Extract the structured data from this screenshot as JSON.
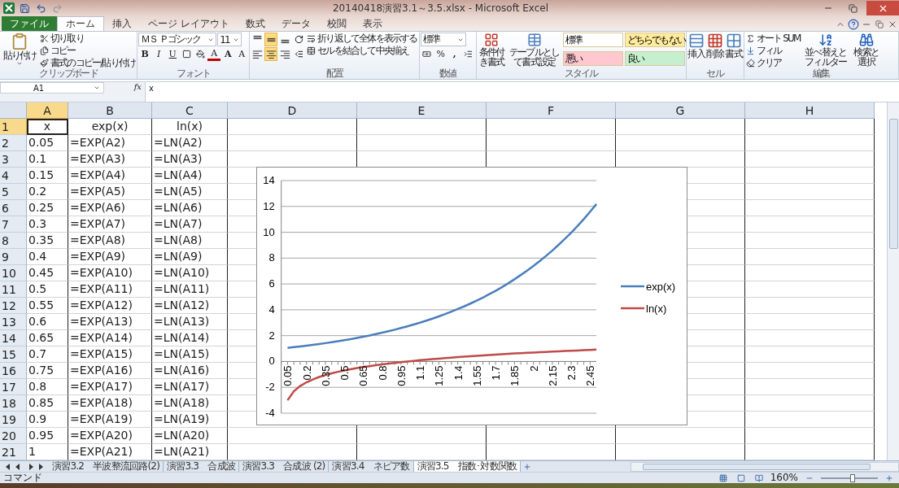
{
  "window": {
    "title": "20140418演習3.1～3.5.xlsx - Microsoft Excel"
  },
  "ribbon_tabs": [
    {
      "label": "ファイル",
      "kind": "file",
      "selected": false
    },
    {
      "label": "ホーム",
      "kind": "tab",
      "selected": true
    },
    {
      "label": "挿入",
      "kind": "tab",
      "selected": false
    },
    {
      "label": "ページ レイアウト",
      "kind": "tab",
      "selected": false
    },
    {
      "label": "数式",
      "kind": "tab",
      "selected": false
    },
    {
      "label": "データ",
      "kind": "tab",
      "selected": false
    },
    {
      "label": "校閲",
      "kind": "tab",
      "selected": false
    },
    {
      "label": "表示",
      "kind": "tab",
      "selected": false
    }
  ],
  "clipboard": {
    "paste": "貼り付け",
    "cut": "切り取り",
    "copy": "コピー",
    "format_painter": "書式のコピー/貼り付け",
    "label": "クリップボード"
  },
  "font": {
    "name": "ＭＳ Ｐゴシック",
    "size": "11",
    "grow": "A",
    "shrink": "A",
    "bold": "B",
    "italic": "I",
    "underline": "U",
    "font_color_letter": "A",
    "label": "フォント"
  },
  "alignment": {
    "vertical": [
      {
        "kind": "top",
        "selected": false
      },
      {
        "kind": "middle",
        "selected": true
      },
      {
        "kind": "bottom",
        "selected": false
      }
    ],
    "horizontal": [
      {
        "kind": "left",
        "selected": false
      },
      {
        "kind": "center",
        "selected": true
      },
      {
        "kind": "right",
        "selected": false
      }
    ],
    "wrap": "折り返して全体を表示する",
    "merge": "セルを結合して中央揃え",
    "label": "配置"
  },
  "number": {
    "format": "標準",
    "percent": "%",
    "comma": ",",
    "label": "数値"
  },
  "styles": {
    "conditional": "条件付き書式",
    "table": "テーブルとして書式設定",
    "cells": [
      {
        "label": "標準",
        "color": "#ffffff"
      },
      {
        "label": "どちらでもない",
        "color": "#ffeb9c"
      },
      {
        "label": "悪い",
        "color": "#ffc7ce"
      },
      {
        "label": "良い",
        "color": "#c6efce"
      }
    ],
    "label": "スタイル"
  },
  "cells": {
    "insert": "挿入",
    "delete": "削除",
    "format": "書式",
    "label": "セル"
  },
  "editing": {
    "autosum": "オート SUM",
    "fill": "フィル",
    "clear": "クリア",
    "sort": "並べ替えとフィルター",
    "find": "検索と選択",
    "label": "編集"
  },
  "formula_bar": {
    "name_box": "A1",
    "fx": "fx",
    "value": "x"
  },
  "columns": [
    {
      "label": "A",
      "selected": true
    },
    {
      "label": "B",
      "selected": false
    },
    {
      "label": "C",
      "selected": false
    },
    {
      "label": "D",
      "selected": false
    },
    {
      "label": "E",
      "selected": false
    },
    {
      "label": "F",
      "selected": false
    },
    {
      "label": "G",
      "selected": false
    },
    {
      "label": "H",
      "selected": false
    }
  ],
  "rows": [
    {
      "header": "1",
      "selected": true,
      "kind": "header",
      "cells": [
        "x",
        "exp(x)",
        "ln(x)"
      ]
    },
    {
      "header": "2",
      "selected": false,
      "kind": "data",
      "cells": [
        "0.05",
        "=EXP(A2)",
        "=LN(A2)"
      ]
    },
    {
      "header": "3",
      "selected": false,
      "kind": "data",
      "cells": [
        "0.1",
        "=EXP(A3)",
        "=LN(A3)"
      ]
    },
    {
      "header": "4",
      "selected": false,
      "kind": "data",
      "cells": [
        "0.15",
        "=EXP(A4)",
        "=LN(A4)"
      ]
    },
    {
      "header": "5",
      "selected": false,
      "kind": "data",
      "cells": [
        "0.2",
        "=EXP(A5)",
        "=LN(A5)"
      ]
    },
    {
      "header": "6",
      "selected": false,
      "kind": "data",
      "cells": [
        "0.25",
        "=EXP(A6)",
        "=LN(A6)"
      ]
    },
    {
      "header": "7",
      "selected": false,
      "kind": "data",
      "cells": [
        "0.3",
        "=EXP(A7)",
        "=LN(A7)"
      ]
    },
    {
      "header": "8",
      "selected": false,
      "kind": "data",
      "cells": [
        "0.35",
        "=EXP(A8)",
        "=LN(A8)"
      ]
    },
    {
      "header": "9",
      "selected": false,
      "kind": "data",
      "cells": [
        "0.4",
        "=EXP(A9)",
        "=LN(A9)"
      ]
    },
    {
      "header": "10",
      "selected": false,
      "kind": "data",
      "cells": [
        "0.45",
        "=EXP(A10)",
        "=LN(A10)"
      ]
    },
    {
      "header": "11",
      "selected": false,
      "kind": "data",
      "cells": [
        "0.5",
        "=EXP(A11)",
        "=LN(A11)"
      ]
    },
    {
      "header": "12",
      "selected": false,
      "kind": "data",
      "cells": [
        "0.55",
        "=EXP(A12)",
        "=LN(A12)"
      ]
    },
    {
      "header": "13",
      "selected": false,
      "kind": "data",
      "cells": [
        "0.6",
        "=EXP(A13)",
        "=LN(A13)"
      ]
    },
    {
      "header": "14",
      "selected": false,
      "kind": "data",
      "cells": [
        "0.65",
        "=EXP(A14)",
        "=LN(A14)"
      ]
    },
    {
      "header": "15",
      "selected": false,
      "kind": "data",
      "cells": [
        "0.7",
        "=EXP(A15)",
        "=LN(A15)"
      ]
    },
    {
      "header": "16",
      "selected": false,
      "kind": "data",
      "cells": [
        "0.75",
        "=EXP(A16)",
        "=LN(A16)"
      ]
    },
    {
      "header": "17",
      "selected": false,
      "kind": "data",
      "cells": [
        "0.8",
        "=EXP(A17)",
        "=LN(A17)"
      ]
    },
    {
      "header": "18",
      "selected": false,
      "kind": "data",
      "cells": [
        "0.85",
        "=EXP(A18)",
        "=LN(A18)"
      ]
    },
    {
      "header": "19",
      "selected": false,
      "kind": "data",
      "cells": [
        "0.9",
        "=EXP(A19)",
        "=LN(A19)"
      ]
    },
    {
      "header": "20",
      "selected": false,
      "kind": "data",
      "cells": [
        "0.95",
        "=EXP(A20)",
        "=LN(A20)"
      ]
    },
    {
      "header": "21",
      "selected": false,
      "kind": "data",
      "cells": [
        "1",
        "=EXP(A21)",
        "=LN(A21)"
      ]
    }
  ],
  "chart": {
    "chart_data": {
      "type": "line",
      "x": [
        0.05,
        0.1,
        0.15,
        0.2,
        0.25,
        0.3,
        0.35,
        0.4,
        0.45,
        0.5,
        0.55,
        0.6,
        0.65,
        0.7,
        0.75,
        0.8,
        0.85,
        0.9,
        0.95,
        1,
        1.05,
        1.1,
        1.15,
        1.2,
        1.25,
        1.3,
        1.35,
        1.4,
        1.45,
        1.5,
        1.55,
        1.6,
        1.65,
        1.7,
        1.75,
        1.8,
        1.85,
        1.9,
        1.95,
        2,
        2.05,
        2.1,
        2.15,
        2.2,
        2.25,
        2.3,
        2.35,
        2.4,
        2.45,
        2.5
      ],
      "series": [
        {
          "name": "exp(x)",
          "color": "#4a7ebb",
          "values": [
            1.05,
            1.11,
            1.16,
            1.22,
            1.28,
            1.35,
            1.42,
            1.49,
            1.57,
            1.65,
            1.73,
            1.82,
            1.92,
            2.01,
            2.12,
            2.23,
            2.34,
            2.46,
            2.59,
            2.72,
            2.86,
            3,
            3.16,
            3.32,
            3.49,
            3.67,
            3.86,
            4.06,
            4.26,
            4.48,
            4.71,
            4.95,
            5.21,
            5.47,
            5.75,
            6.05,
            6.36,
            6.69,
            7.03,
            7.39,
            7.77,
            8.17,
            8.58,
            9.03,
            9.49,
            9.97,
            10.49,
            11.02,
            11.59,
            12.18
          ]
        },
        {
          "name": "ln(x)",
          "color": "#be4b48",
          "values": [
            -3,
            -2.3,
            -1.9,
            -1.61,
            -1.39,
            -1.2,
            -1.05,
            -0.92,
            -0.8,
            -0.69,
            -0.6,
            -0.51,
            -0.43,
            -0.36,
            -0.29,
            -0.22,
            -0.16,
            -0.11,
            -0.05,
            0,
            0.05,
            0.1,
            0.14,
            0.18,
            0.22,
            0.26,
            0.3,
            0.34,
            0.37,
            0.41,
            0.44,
            0.47,
            0.5,
            0.53,
            0.56,
            0.59,
            0.62,
            0.64,
            0.67,
            0.69,
            0.72,
            0.74,
            0.77,
            0.79,
            0.81,
            0.83,
            0.85,
            0.88,
            0.9,
            0.92
          ]
        }
      ],
      "xlim": [
        0,
        2.5
      ],
      "xticks": [
        {
          "value": 0.05,
          "label": "0.05"
        },
        {
          "value": 0.2,
          "label": "0.2"
        },
        {
          "value": 0.35,
          "label": "0.35"
        },
        {
          "value": 0.5,
          "label": "0.5"
        },
        {
          "value": 0.65,
          "label": "0.65"
        },
        {
          "value": 0.8,
          "label": "0.8"
        },
        {
          "value": 0.95,
          "label": "0.95"
        },
        {
          "value": 1.1,
          "label": "1.1"
        },
        {
          "value": 1.25,
          "label": "1.25"
        },
        {
          "value": 1.4,
          "label": "1.4"
        },
        {
          "value": 1.55,
          "label": "1.55"
        },
        {
          "value": 1.7,
          "label": "1.7"
        },
        {
          "value": 1.85,
          "label": "1.85"
        },
        {
          "value": 2,
          "label": "2"
        },
        {
          "value": 2.15,
          "label": "2.15"
        },
        {
          "value": 2.3,
          "label": "2.3"
        },
        {
          "value": 2.45,
          "label": "2.45"
        }
      ],
      "ylim": [
        -4,
        14
      ],
      "yticks": [
        {
          "value": -4,
          "label": "-4"
        },
        {
          "value": -2,
          "label": "-2"
        },
        {
          "value": 0,
          "label": "0"
        },
        {
          "value": 2,
          "label": "2"
        },
        {
          "value": 4,
          "label": "4"
        },
        {
          "value": 6,
          "label": "6"
        },
        {
          "value": 8,
          "label": "8"
        },
        {
          "value": 10,
          "label": "10"
        },
        {
          "value": 12,
          "label": "12"
        },
        {
          "value": 14,
          "label": "14"
        }
      ],
      "grid": true,
      "legend": "right"
    }
  },
  "sheet_tabs": [
    {
      "label": "演習3.2　半波整流回路(2)",
      "selected": false
    },
    {
      "label": "演習3.3　合成波",
      "selected": false
    },
    {
      "label": "演習3.3　合成波 (2)",
      "selected": false
    },
    {
      "label": "演習3.4　ネピア数",
      "selected": false
    },
    {
      "label": "演習3.5　指数･対数関数",
      "selected": true
    }
  ],
  "status_bar": {
    "mode": "コマンド",
    "zoom": "160%",
    "zoom_slider": {
      "level": 0.55
    }
  }
}
